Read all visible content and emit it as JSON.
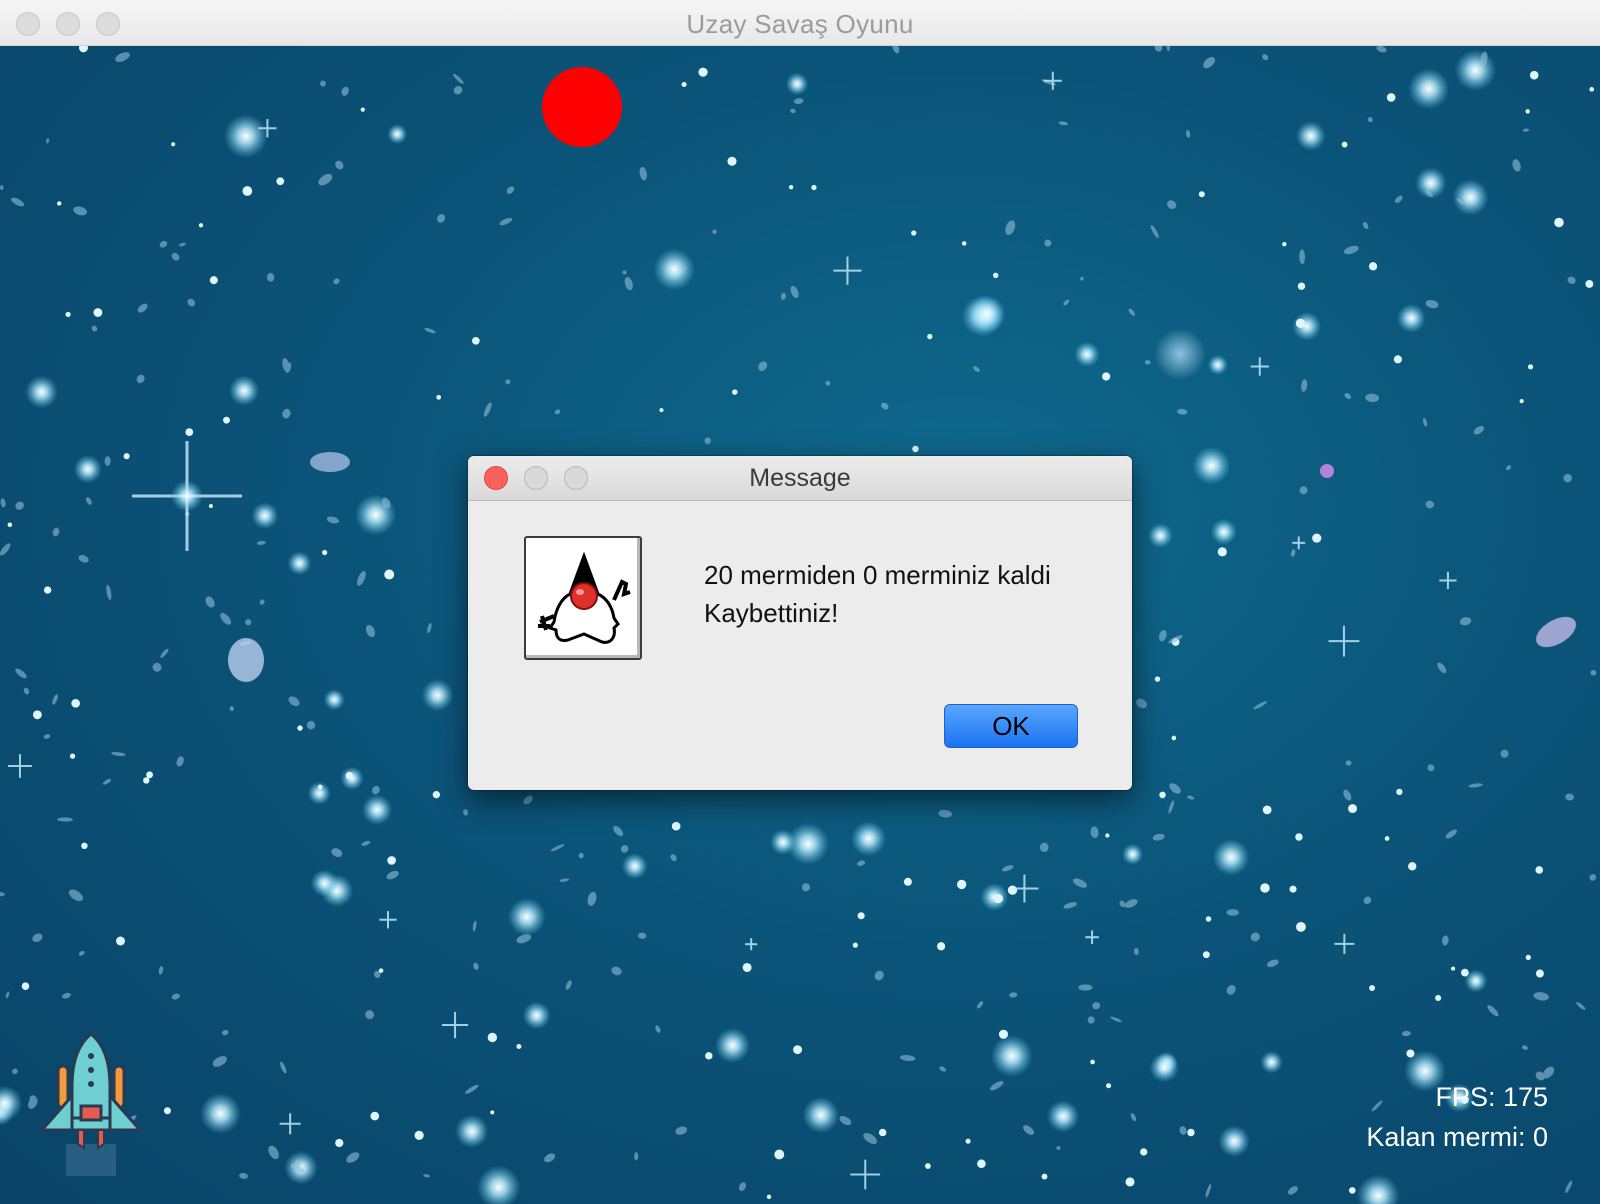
{
  "window": {
    "title": "Uzay Savaş Oyunu"
  },
  "hud": {
    "fps": "FPS: 175",
    "ammo": "Kalan mermi: 0"
  },
  "dialog": {
    "title": "Message",
    "line1": "20 mermiden 0 merminiz kaldi",
    "line2": "Kaybettiniz!",
    "ok_label": "OK",
    "icon": "java-duke-icon"
  },
  "colors": {
    "enemy": "#ff0000",
    "background": "#0b5479",
    "ok_button": "#1b73f0",
    "close_button": "#fc605c"
  }
}
